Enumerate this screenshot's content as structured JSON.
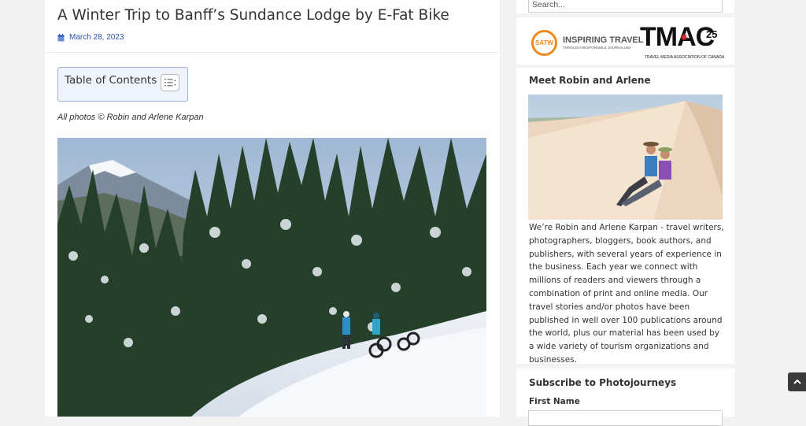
{
  "post": {
    "title": "A Winter Trip to Banff’s Sundance Lodge by E-Fat Bike",
    "date": "March 28, 2023",
    "date_icon": "calendar-icon",
    "photo_credit": "All photos © Robin and Arlene Karpan"
  },
  "toc": {
    "title": "Table of Contents",
    "toggle_icon": "list-toggle-icon"
  },
  "sidebar": {
    "search_placeholder": "Search...",
    "logos": {
      "satw_badge": "SATW",
      "satw_name": "INSPIRING TRAVEL",
      "satw_tagline": "THROUGH RESPONSIBLE JOURNALISM",
      "tmac_name": "TMAC",
      "tmac_number": "25",
      "tmac_tagline": "TRAVEL MEDIA ASSOCIATION OF CANADA"
    },
    "about_title": "Meet Robin and Arlene",
    "about_text": "We’re Robin and Arlene Karpan - travel writers, photographers, bloggers, book authors, and publishers, with several years of experience in the business. Each year we connect with millions of readers and viewers through a combination of print and online media. Our travel stories and/or photos have been published in well over 100 publications around the world, plus our material has been used by a wide variety of tourism organizations and businesses.",
    "subscribe_title": "Subscribe to Photojourneys",
    "first_name_label": "First Name"
  },
  "back_to_top_icon": "chevron-up-icon",
  "colors": {
    "link_blue": "#2a4fb3",
    "toc_border": "#9bb2d9",
    "satw_orange": "#f08a1c",
    "tmac_red": "#d7262b"
  }
}
